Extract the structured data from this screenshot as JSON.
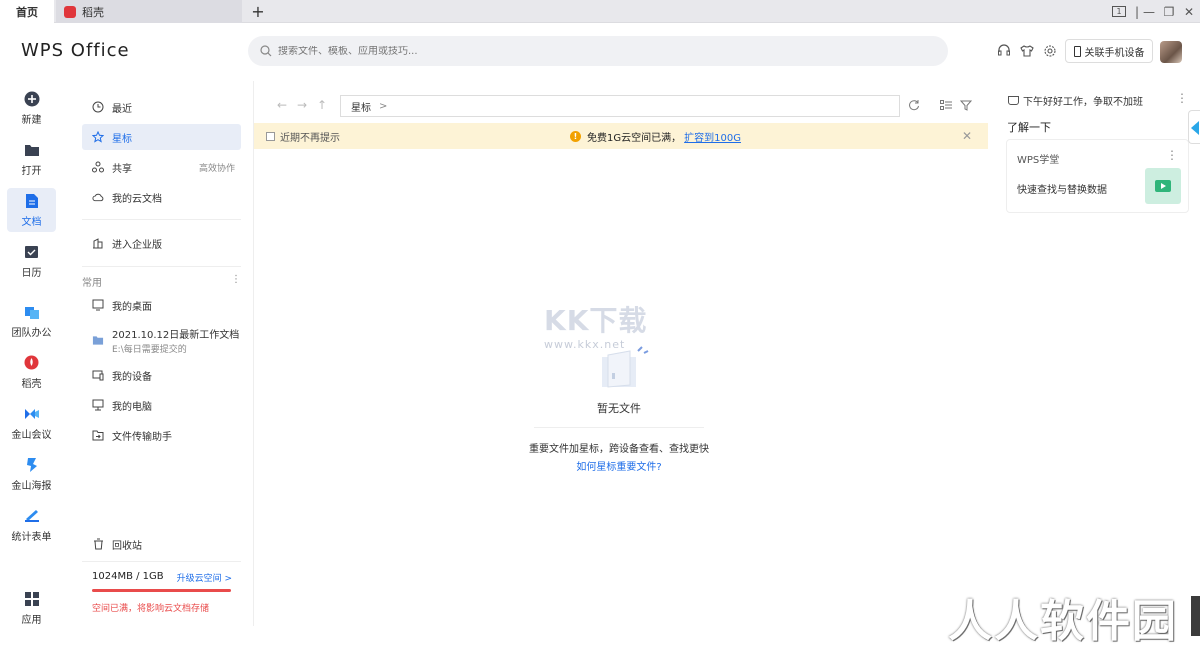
{
  "tabs": {
    "home": "首页",
    "daoke": "稻壳",
    "add": "+"
  },
  "window_controls": {
    "one": "1",
    "minimize": "—",
    "restore": "❐",
    "close": "✕"
  },
  "header": {
    "brand": "WPS Office",
    "search_placeholder": "搜索文件、模板、应用或技巧...",
    "phone_button": "关联手机设备"
  },
  "rail": {
    "items": [
      {
        "label": "新建"
      },
      {
        "label": "打开"
      },
      {
        "label": "文档"
      },
      {
        "label": "日历"
      },
      {
        "label": "团队办公"
      },
      {
        "label": "稻壳"
      },
      {
        "label": "金山会议"
      },
      {
        "label": "金山海报"
      },
      {
        "label": "统计表单"
      },
      {
        "label": "应用"
      }
    ]
  },
  "nav": {
    "recent": "最近",
    "starred": "星标",
    "shared": "共享",
    "shared_extra": "高效协作",
    "cloud": "我的云文档",
    "enterprise": "进入企业版",
    "section_common": "常用",
    "section_more": "⋮",
    "desktop": "我的桌面",
    "folder_title": "2021.10.12日最新工作文档",
    "folder_path": "E:\\每日需要提交的",
    "devices": "我的设备",
    "computer": "我的电脑",
    "transfer": "文件传输助手",
    "recycle": "回收站",
    "storage_used": "1024MB / 1GB",
    "storage_upgrade": "升级云空间 >",
    "storage_fraction": 1.0,
    "storage_warning": "空间已满，将影响云文档存储"
  },
  "main": {
    "path_label": "星标",
    "path_chevron": ">",
    "notice_checkbox": "近期不再提示",
    "notice_text": "免费1G云空间已满，",
    "notice_link": "扩容到100G",
    "notice_close": "✕",
    "watermark": "KK下载",
    "watermark_url": "www.kkx.net",
    "empty_title": "暂无文件",
    "empty_desc": "重要文件加星标，跨设备查看、查找更快",
    "empty_link": "如何星标重要文件?"
  },
  "right_panel": {
    "greeting": "下午好好工作，争取不加班",
    "greeting_more": "⋮",
    "learn": "了解一下",
    "card_head": "WPS学堂",
    "card_more": "⋮",
    "card_body": "快速查找与替换数据"
  },
  "corner_watermark": "人人软件园",
  "colors": {
    "accent": "#1f6ee8",
    "warning": "#e94b4b",
    "notice_bg": "#fdf3d6"
  }
}
